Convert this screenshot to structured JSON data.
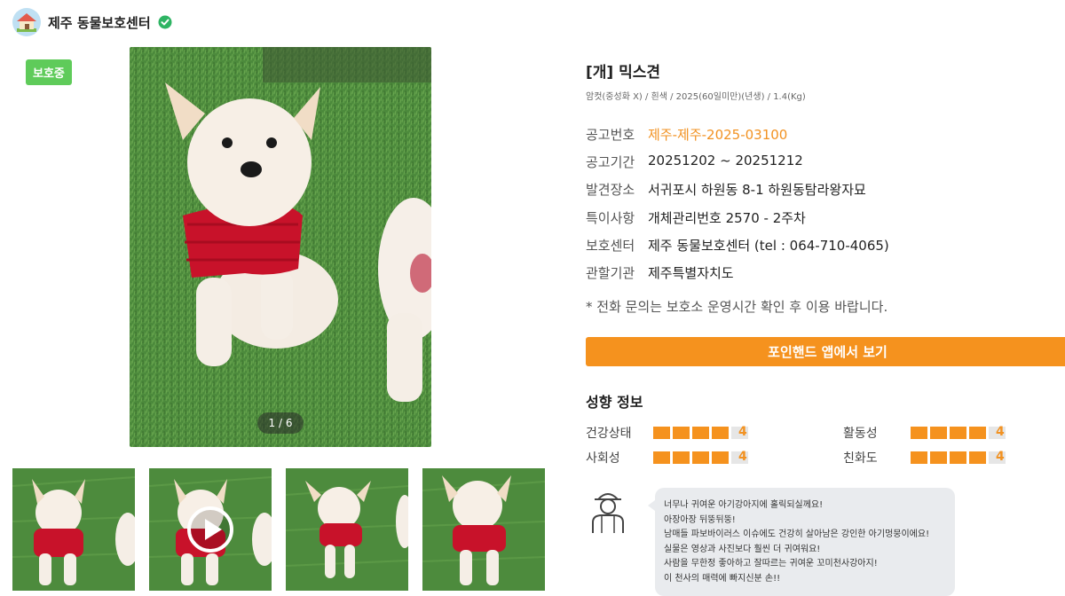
{
  "header": {
    "shelter_name": "제주 동물보호센터"
  },
  "status_badge": "보호중",
  "photo_counter": "1 / 6",
  "animal": {
    "title": "[개] 믹스견",
    "subtitle": "암컷(중성화 X) / 흰색 / 2025(60일미만)(년생) / 1.4(Kg)"
  },
  "info": [
    {
      "label": "공고번호",
      "value": "제주-제주-2025-03100"
    },
    {
      "label": "공고기간",
      "value": "20251202 ~ 20251212"
    },
    {
      "label": "발견장소",
      "value": "서귀포시 하원동 8-1 하원동탐라왕자묘"
    },
    {
      "label": "특이사항",
      "value": "개체관리번호 2570 - 2주차"
    },
    {
      "label": "보호센터",
      "value": "제주 동물보호센터 (tel : 064-710-4065)"
    },
    {
      "label": "관할기관",
      "value": "제주특별자치도"
    }
  ],
  "notice": "* 전화 문의는 보호소 운영시간 확인 후 이용 바랍니다.",
  "app_button": "포인핸드 앱에서 보기",
  "traits_title": "성향 정보",
  "traits": [
    {
      "label": "건강상태",
      "score": 4,
      "max": 5,
      "score_text": "4"
    },
    {
      "label": "활동성",
      "score": 4,
      "max": 5,
      "score_text": "4"
    },
    {
      "label": "사회성",
      "score": 4,
      "max": 5,
      "score_text": "4"
    },
    {
      "label": "친화도",
      "score": 4,
      "max": 5,
      "score_text": "4"
    }
  ],
  "comment": [
    "너무나 귀여운 아기강아지에 홀릭되실께요!",
    "아장아장 뒤뚱뒤뚱!",
    "남매들 파보바이러스 이슈에도 건강히 살아남은 강인한 아기멍뭉이에요!",
    "실물은 영상과 사진보다 훨씬 더 귀여워요!",
    "사람을 무한정 좋아하고 잘따르는 귀여운 꼬미천사강아지!",
    "이 천사의 매력에 빠지신분 손!!"
  ],
  "icons": {
    "avatar": "shelter-house-icon",
    "verified": "verified-check-icon",
    "play": "play-icon",
    "caretaker": "caretaker-icon"
  },
  "colors": {
    "accent": "#f5921e",
    "status": "#5fcb5a",
    "bubble": "#e9ebee"
  }
}
